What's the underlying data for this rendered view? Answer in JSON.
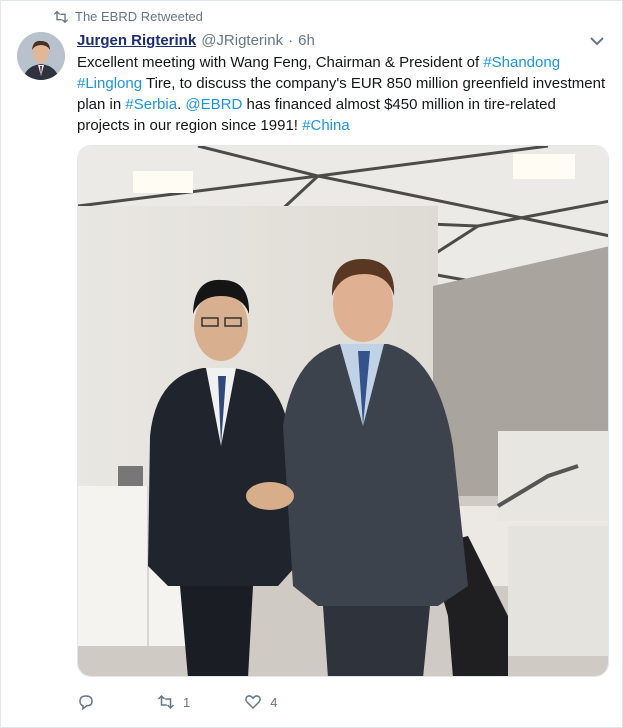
{
  "retweet": {
    "label": "The EBRD Retweeted",
    "icon": "retweet-icon"
  },
  "author": {
    "name": "Jurgen Rigterink",
    "handle": "@JRigterink",
    "separator": "·",
    "time": "6h"
  },
  "tweet": {
    "segments": [
      {
        "text": "Excellent meeting with Wang Feng, Chairman & President of ",
        "link": false
      },
      {
        "text": "#Shandong",
        "link": true
      },
      {
        "text": " ",
        "link": false
      },
      {
        "text": "#Linglong",
        "link": true
      },
      {
        "text": " Tire, to discuss the company's EUR 850 million greenfield investment plan in ",
        "link": false
      },
      {
        "text": "#Serbia",
        "link": true
      },
      {
        "text": ". ",
        "link": false
      },
      {
        "text": "@EBRD",
        "link": true
      },
      {
        "text": " has financed almost $450 million in tire-related projects in our region since 1991! ",
        "link": false
      },
      {
        "text": "#China",
        "link": true
      }
    ],
    "link_color": "#1b95e0"
  },
  "actions": {
    "reply": "",
    "retweet": "1",
    "like": "4"
  },
  "icons": {
    "reply": "reply-icon",
    "retweet": "retweet-icon",
    "like": "heart-icon",
    "menu": "chevron-down-icon"
  }
}
